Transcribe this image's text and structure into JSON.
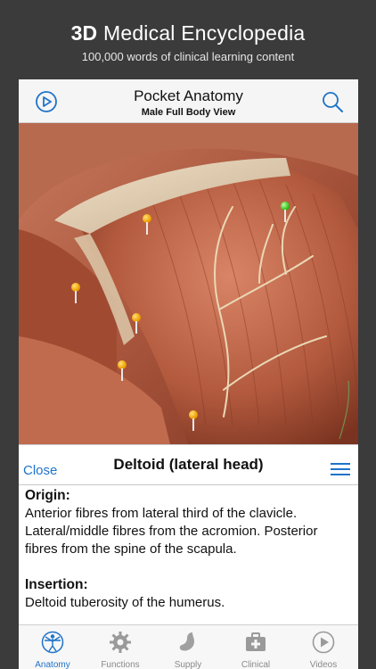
{
  "promo": {
    "title_bold": "3D",
    "title_rest": " Medical Encyclopedia",
    "subtitle": "100,000 words of clinical learning content"
  },
  "nav": {
    "title": "Pocket Anatomy",
    "subtitle": "Male Full Body View",
    "left_icon": "play-circle-icon",
    "right_icon": "search-icon"
  },
  "info": {
    "close_label": "Close",
    "title": "Deltoid (lateral head)",
    "origin_label": "Origin:",
    "origin_text": "Anterior fibres from lateral third of the clavicle. Lateral/middle fibres from the acromion. Posterior fibres from the spine of the scapula.",
    "insertion_label": "Insertion:",
    "insertion_text": "Deltoid tuberosity of the humerus."
  },
  "tabs": [
    {
      "label": "Anatomy",
      "icon": "vitruvian-man-icon",
      "active": true
    },
    {
      "label": "Functions",
      "icon": "gear-icon",
      "active": false
    },
    {
      "label": "Supply",
      "icon": "stomach-icon",
      "active": false
    },
    {
      "label": "Clinical",
      "icon": "first-aid-kit-icon",
      "active": false
    },
    {
      "label": "Videos",
      "icon": "play-circle-icon",
      "active": false
    }
  ],
  "colors": {
    "accent": "#1f73c9",
    "muscle": "#b85a3f",
    "background": "#3b3b3b",
    "pin_default": "#f0a000",
    "pin_selected": "#38c21e"
  }
}
